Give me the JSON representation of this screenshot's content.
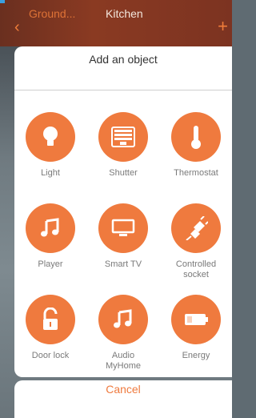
{
  "header": {
    "previous_room": "Ground...",
    "room_title": "Kitchen",
    "back_icon": "chevron-left-icon",
    "add_icon": "plus-icon"
  },
  "dialog": {
    "title": "Add an object",
    "objects": [
      {
        "label": "Light",
        "icon": "light-bulb-icon"
      },
      {
        "label": "Shutter",
        "icon": "shutter-icon"
      },
      {
        "label": "Thermostat",
        "icon": "thermometer-icon"
      },
      {
        "label": "Player",
        "icon": "music-note-icon"
      },
      {
        "label": "Smart TV",
        "icon": "tv-icon"
      },
      {
        "label": "Controlled\nsocket",
        "icon": "plug-icon"
      },
      {
        "label": "Door lock",
        "icon": "unlocked-padlock-icon"
      },
      {
        "label": "Audio\nMyHome",
        "icon": "music-note-icon"
      },
      {
        "label": "Energy",
        "icon": "battery-icon"
      }
    ],
    "cancel_label": "Cancel"
  },
  "colors": {
    "accent": "#ef7a3e",
    "label_gray": "#7a7a7a"
  }
}
